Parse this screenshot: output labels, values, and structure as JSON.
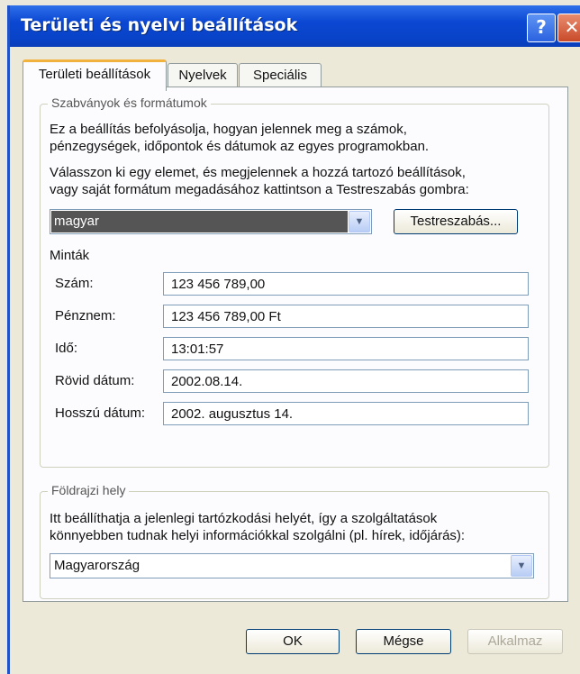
{
  "window": {
    "title": "Területi és nyelvi beállítások",
    "help_glyph": "?",
    "close_glyph": "✕"
  },
  "tabs": [
    {
      "label": "Területi beállítások",
      "active": true
    },
    {
      "label": "Nyelvek",
      "active": false
    },
    {
      "label": "Speciális",
      "active": false
    }
  ],
  "standards": {
    "legend": "Szabványok és formátumok",
    "desc_line1": "Ez a beállítás befolyásolja, hogyan jelennek meg a számok,",
    "desc_line2": "pénzegységek, időpontok és dátumok az egyes programokban.",
    "choose_line1": "Válasszon ki egy elemet, és megjelennek a hozzá tartozó beállítások,",
    "choose_line2": "vagy saját formátum megadásához kattintson a Testreszabás gombra:",
    "locale_value": "magyar",
    "customize_label": "Testreszabás...",
    "samples_heading": "Minták",
    "samples": [
      {
        "label": "Szám:",
        "value": "123 456 789,00"
      },
      {
        "label": "Pénznem:",
        "value": "123 456 789,00 Ft"
      },
      {
        "label": "Idő:",
        "value": "13:01:57"
      },
      {
        "label": "Rövid dátum:",
        "value": "2002.08.14."
      },
      {
        "label": "Hosszú dátum:",
        "value": "2002. augusztus 14."
      }
    ]
  },
  "location": {
    "legend": "Földrajzi hely",
    "desc_line1": "Itt beállíthatja a jelenlegi tartózkodási helyét, így a szolgáltatások",
    "desc_line2": "könnyebben tudnak helyi információkkal szolgálni (pl. hírek, időjárás):",
    "value": "Magyarország"
  },
  "footer": {
    "ok_label": "OK",
    "cancel_label": "Mégse",
    "apply_label": "Alkalmaz"
  },
  "icons": {
    "dropdown": "chevron-down-icon"
  },
  "colors": {
    "titlebar": "#0b47d2",
    "tab_highlight": "#f2b33e",
    "dialog_bg": "#ece9d8"
  }
}
